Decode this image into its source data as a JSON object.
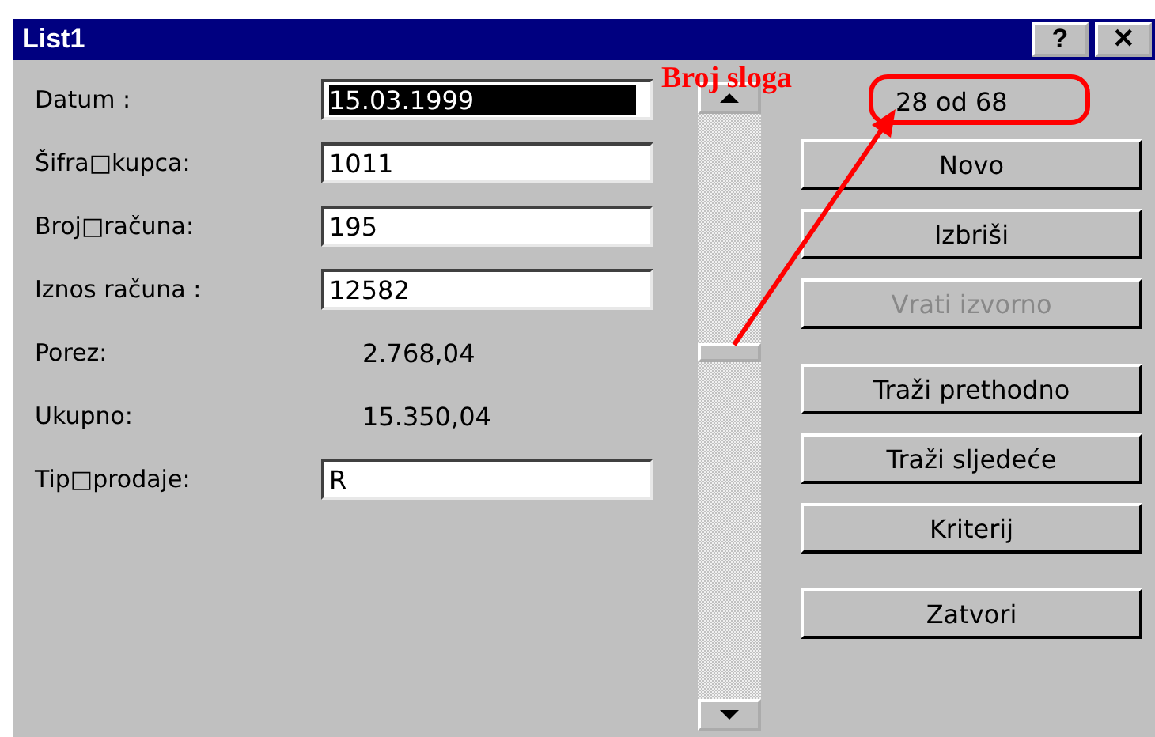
{
  "window": {
    "title": "List1",
    "help_button": "?",
    "close_button": "✕"
  },
  "fields": [
    {
      "label": "Datum :",
      "kind": "input",
      "value": "15.03.1999",
      "selected": true
    },
    {
      "label": "Šifra□kupca:",
      "kind": "input",
      "value": "1011",
      "selected": false
    },
    {
      "label": "Broj□računa:",
      "kind": "input",
      "value": "195",
      "selected": false
    },
    {
      "label": "Iznos računa :",
      "kind": "input",
      "value": "12582",
      "selected": false
    },
    {
      "label": "Porez:",
      "kind": "computed",
      "value": "2.768,04"
    },
    {
      "label": "Ukupno:",
      "kind": "computed",
      "value": "15.350,04"
    },
    {
      "label": "Tip□prodaje:",
      "kind": "input",
      "value": "R",
      "selected": false
    }
  ],
  "record_counter": "28 od 68",
  "buttons": [
    {
      "label": "Novo",
      "disabled": false
    },
    {
      "label": "Izbriši",
      "disabled": false
    },
    {
      "label": "Vrati izvorno",
      "disabled": true
    },
    {
      "label": "Traži prethodno",
      "disabled": false
    },
    {
      "label": "Traži sljedeće",
      "disabled": false
    },
    {
      "label": "Kriterij",
      "disabled": false
    },
    {
      "label": "Zatvori",
      "disabled": false
    }
  ],
  "annotation": {
    "label": "Broj sloga"
  }
}
